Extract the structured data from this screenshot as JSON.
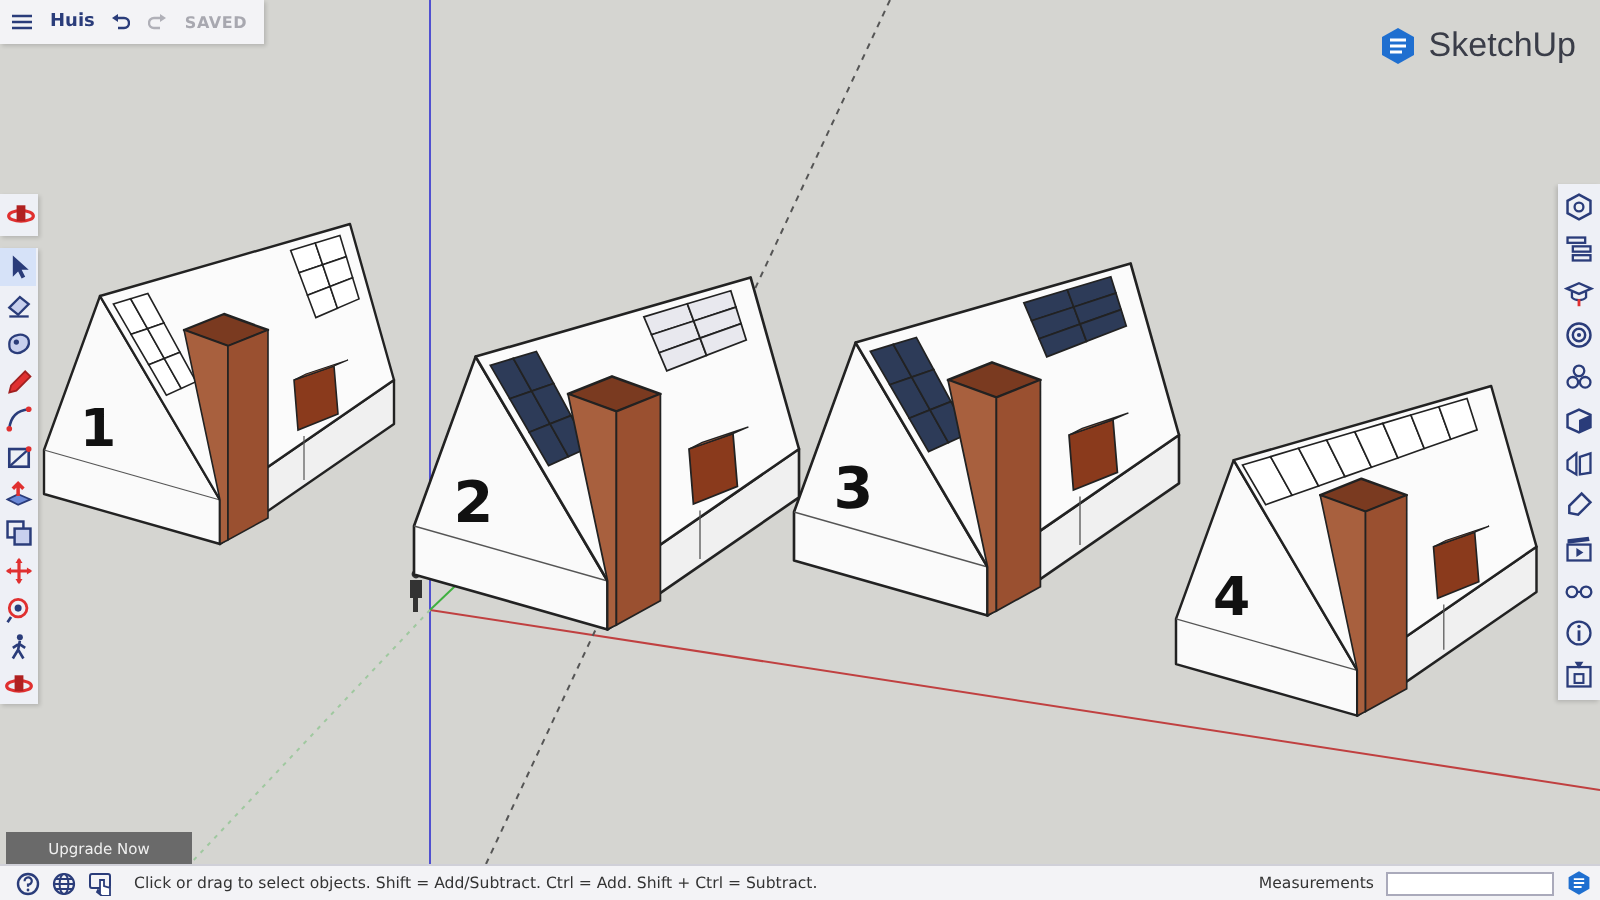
{
  "header": {
    "title": "Huis",
    "status": "SAVED"
  },
  "brand": {
    "name": "SketchUp"
  },
  "top_tool": {
    "kind": "orbit"
  },
  "tools": [
    {
      "kind": "select",
      "selected": true
    },
    {
      "kind": "eraser",
      "selected": false
    },
    {
      "kind": "paint",
      "selected": false
    },
    {
      "kind": "pencil",
      "selected": false
    },
    {
      "kind": "arc",
      "selected": false
    },
    {
      "kind": "rectangle",
      "selected": false
    },
    {
      "kind": "pushpull",
      "selected": false
    },
    {
      "kind": "offset",
      "selected": false
    },
    {
      "kind": "move",
      "selected": false
    },
    {
      "kind": "tape",
      "selected": false
    },
    {
      "kind": "walk",
      "selected": false
    },
    {
      "kind": "orbit",
      "selected": false
    }
  ],
  "panels": [
    {
      "kind": "entity"
    },
    {
      "kind": "outliner"
    },
    {
      "kind": "instructor"
    },
    {
      "kind": "materials"
    },
    {
      "kind": "components"
    },
    {
      "kind": "styles"
    },
    {
      "kind": "scenes"
    },
    {
      "kind": "tags"
    },
    {
      "kind": "animation"
    },
    {
      "kind": "display"
    },
    {
      "kind": "info"
    },
    {
      "kind": "solar"
    }
  ],
  "houses": [
    {
      "label": "1"
    },
    {
      "label": "2"
    },
    {
      "label": "3"
    },
    {
      "label": "4"
    }
  ],
  "upgrade_button": "Upgrade Now",
  "status_bar": {
    "hint": "Click or drag to select objects. Shift = Add/Subtract. Ctrl = Add. Shift + Ctrl = Subtract.",
    "measurements_label": "Measurements"
  }
}
